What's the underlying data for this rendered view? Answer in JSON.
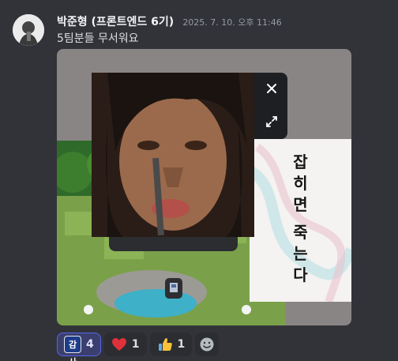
{
  "message": {
    "username": "박준형 (프론트엔드 6기)",
    "timestamp": "2025. 7. 10. 오후 11:46",
    "text": "5팀분들 무서워요"
  },
  "attachment": {
    "right_card_text": [
      "잡",
      "히",
      "면",
      "죽",
      "는",
      "다"
    ],
    "close_icon": "close-icon",
    "expand_icon": "expand-icon"
  },
  "reactions": [
    {
      "emoji": "감사",
      "count": "4",
      "active": true
    },
    {
      "emoji": "heart",
      "count": "1",
      "active": false
    },
    {
      "emoji": "thumbs-up",
      "count": "1",
      "active": false
    }
  ],
  "colors": {
    "background": "#323339",
    "accent": "#5865f2",
    "heart": "#e0313b",
    "thumbs": "#f7c23a"
  }
}
